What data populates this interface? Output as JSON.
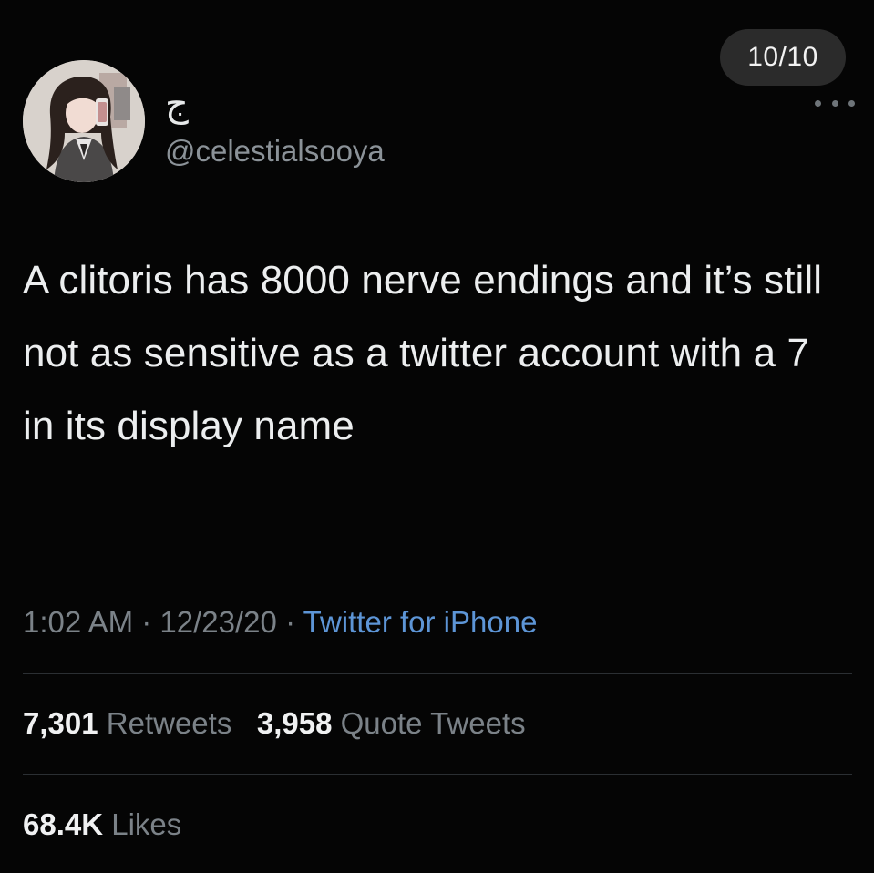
{
  "viewer": {
    "counter": "10/10"
  },
  "tweet": {
    "display_name": "ج",
    "handle": "@celestialsooya",
    "text": "A clitoris has 8000 nerve endings and it’s still not as sensitive as a twitter account with a 7 in its display name",
    "time": "1:02 AM",
    "date": "12/23/20",
    "separator": "·",
    "source": "Twitter for iPhone"
  },
  "stats": {
    "retweets_count": "7,301",
    "retweets_label": "Retweets",
    "quotes_count": "3,958",
    "quotes_label": "Quote Tweets",
    "likes_count": "68.4K",
    "likes_label": "Likes"
  },
  "icons": {
    "more": "more-horizontal-icon"
  },
  "colors": {
    "background": "#050505",
    "text": "#eceeef",
    "secondary": "#7b8288",
    "link": "#5d95d6",
    "divider": "#2b2f33"
  }
}
